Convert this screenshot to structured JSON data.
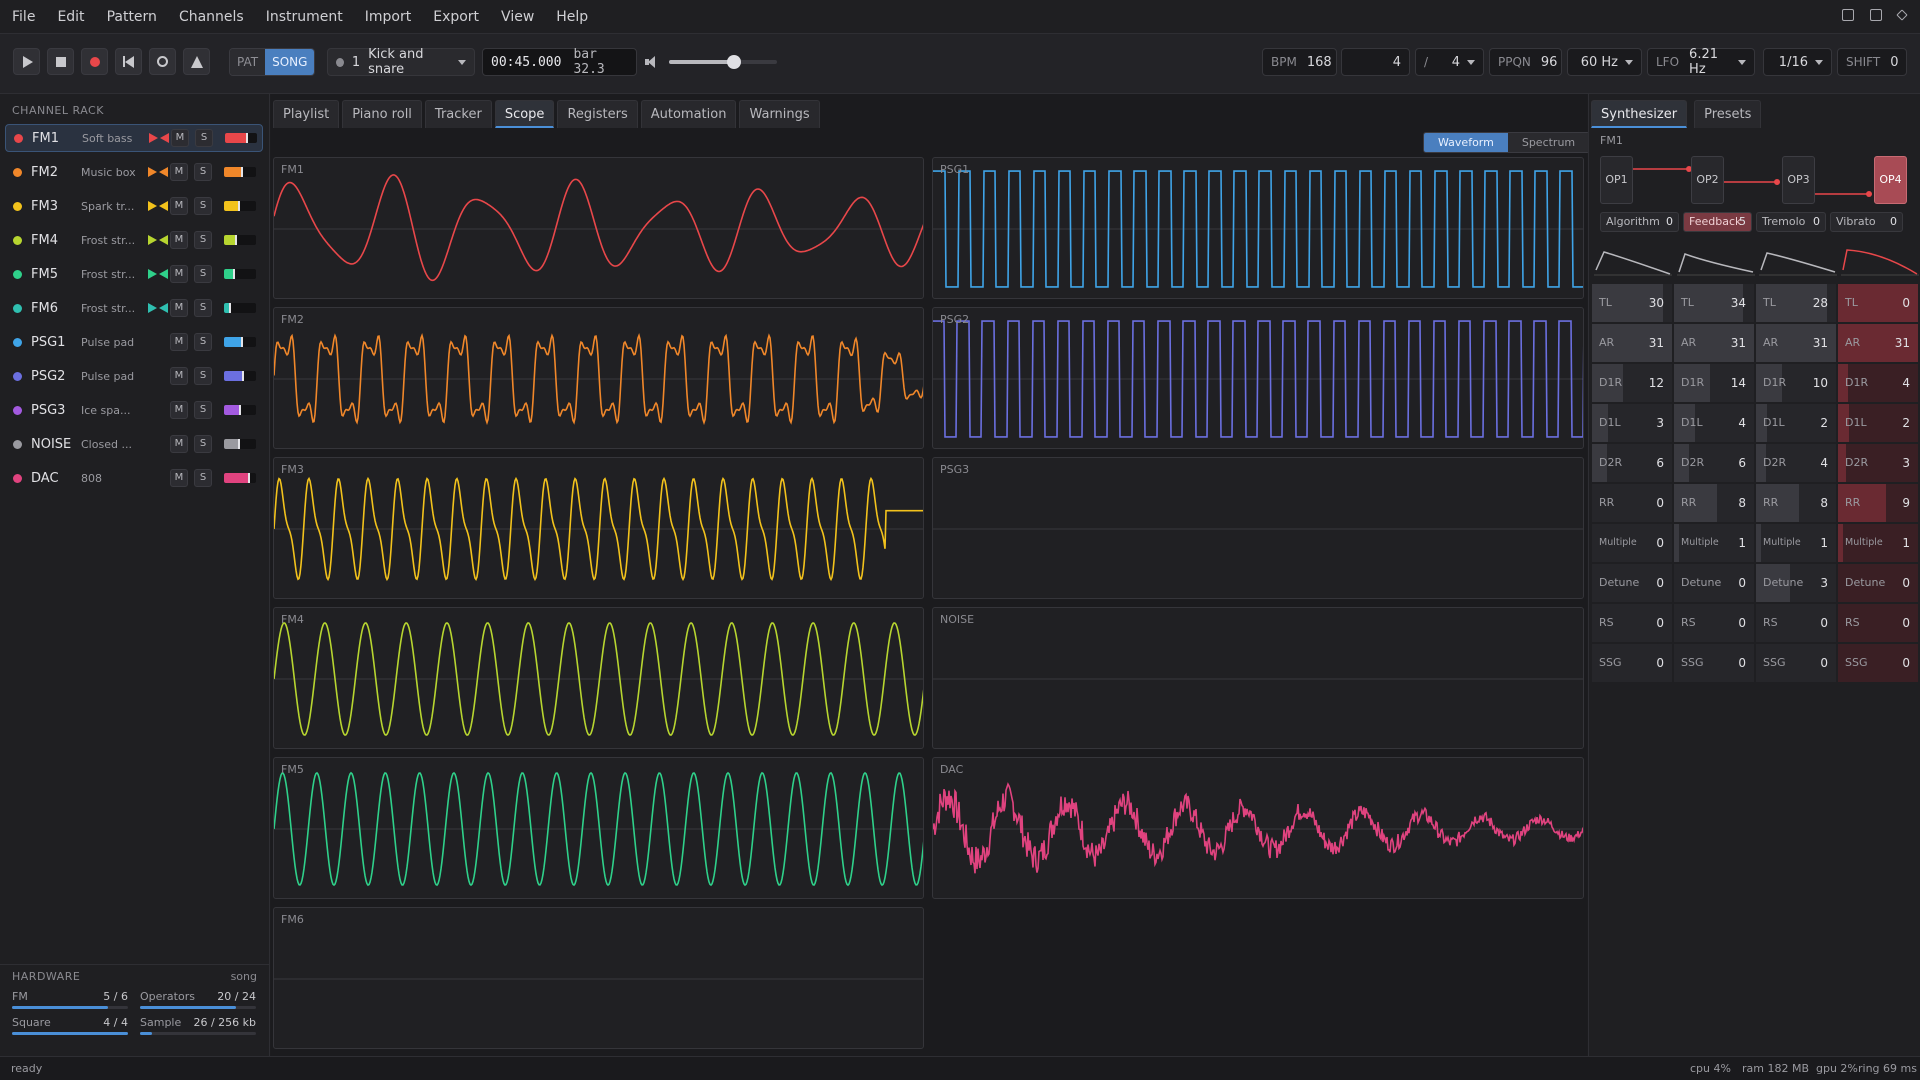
{
  "menu": [
    "File",
    "Edit",
    "Pattern",
    "Channels",
    "Instrument",
    "Import",
    "Export",
    "View",
    "Help"
  ],
  "transport": {
    "mode_pat": "PAT",
    "mode_song": "SONG",
    "pattern_num": "1",
    "pattern_name": "Kick and snare",
    "time": "00:45.000",
    "bar": "bar 32.3",
    "volume": 0.6,
    "bpm_label": "BPM",
    "bpm": "168",
    "beats": "4",
    "slash": "/",
    "beat_unit": "4",
    "ppqn_label": "PPQN",
    "ppqn": "96",
    "rate": "60 Hz",
    "lfo_label": "LFO",
    "lfo": "6.21 Hz",
    "grid": "1/16",
    "shift_label": "SHIFT",
    "shift": "0"
  },
  "channel_rack": {
    "title": "CHANNEL RACK",
    "channels": [
      {
        "name": "FM1",
        "inst": "Soft bass",
        "color": "#e8474a",
        "fm": true,
        "level": 0.7
      },
      {
        "name": "FM2",
        "inst": "Music box",
        "color": "#f0872a",
        "fm": true,
        "level": 0.55
      },
      {
        "name": "FM3",
        "inst": "Spark tr...",
        "color": "#f2c21c",
        "fm": true,
        "level": 0.45
      },
      {
        "name": "FM4",
        "inst": "Frost str...",
        "color": "#b7d530",
        "fm": true,
        "level": 0.35
      },
      {
        "name": "FM5",
        "inst": "Frost str...",
        "color": "#2fd08a",
        "fm": true,
        "level": 0.3
      },
      {
        "name": "FM6",
        "inst": "Frost str...",
        "color": "#2fbfb0",
        "fm": true,
        "level": 0.15
      },
      {
        "name": "PSG1",
        "inst": "Pulse pad",
        "color": "#3fa4e8",
        "fm": false,
        "level": 0.55
      },
      {
        "name": "PSG2",
        "inst": "Pulse pad",
        "color": "#6b6fe0",
        "fm": false,
        "level": 0.6
      },
      {
        "name": "PSG3",
        "inst": "Ice spa...",
        "color": "#a35ae0",
        "fm": false,
        "level": 0.5
      },
      {
        "name": "NOISE",
        "inst": "Closed ...",
        "color": "#9a9aa0",
        "fm": false,
        "level": 0.45
      },
      {
        "name": "DAC",
        "inst": "808",
        "color": "#e0437f",
        "fm": false,
        "level": 0.8
      }
    ],
    "mute": "M",
    "solo": "S"
  },
  "hardware": {
    "title": "HARDWARE",
    "mode": "song",
    "fm_label": "FM",
    "fm_val": "5 / 6",
    "fm_frac": 0.83,
    "ops_label": "Operators",
    "ops_val": "20 / 24",
    "ops_frac": 0.83,
    "sq_label": "Square",
    "sq_val": "4 / 4",
    "sq_frac": 1.0,
    "sample_label": "Sample",
    "sample_val": "26 / 256 kb",
    "sample_frac": 0.1
  },
  "tabs": [
    "Playlist",
    "Piano roll",
    "Tracker",
    "Scope",
    "Registers",
    "Automation",
    "Warnings"
  ],
  "scope_view": {
    "waveform": "Waveform",
    "spectrum": "Spectrum"
  },
  "scopes": {
    "fm1": "FM1",
    "fm2": "FM2",
    "fm3": "FM3",
    "fm4": "FM4",
    "fm5": "FM5",
    "fm6": "FM6",
    "psg1": "PSG1",
    "psg2": "PSG2",
    "psg3": "PSG3",
    "noise": "NOISE",
    "dac": "DAC"
  },
  "synth": {
    "tabs": [
      "Synthesizer",
      "Presets"
    ],
    "channel": "FM1",
    "ops": [
      "OP1",
      "OP2",
      "OP3",
      "OP4"
    ],
    "algorithm_label": "Algorithm",
    "algorithm": "0",
    "feedback_label": "Feedback",
    "feedback": "5",
    "tremolo_label": "Tremolo",
    "tremolo": "0",
    "vibrato_label": "Vibrato",
    "vibrato": "0",
    "params": [
      "TL",
      "AR",
      "D1R",
      "D1L",
      "D2R",
      "RR",
      "Multiple",
      "Detune",
      "RS",
      "SSG"
    ],
    "values": [
      [
        "30",
        "31",
        "12",
        "3",
        "6",
        "0",
        "0",
        "0",
        "0",
        "0"
      ],
      [
        "34",
        "31",
        "14",
        "4",
        "6",
        "8",
        "1",
        "0",
        "0",
        "0"
      ],
      [
        "28",
        "31",
        "10",
        "2",
        "4",
        "8",
        "1",
        "3",
        "0",
        "0"
      ],
      [
        "0",
        "31",
        "4",
        "2",
        "3",
        "9",
        "1",
        "0",
        "0",
        "0"
      ]
    ]
  },
  "status": {
    "text": "ready",
    "cpu": "cpu 4%",
    "ram": "ram 182 MB",
    "gpu": "gpu 2%",
    "ring": "ring 69 ms"
  }
}
